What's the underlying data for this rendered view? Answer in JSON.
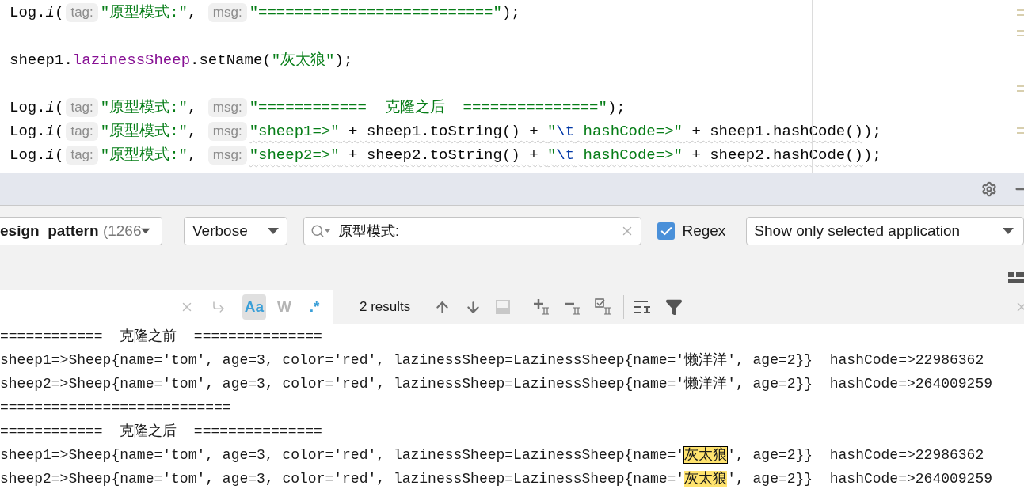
{
  "editor": {
    "lines": [
      {
        "kind": "code",
        "segments": [
          {
            "kind": "plain",
            "text": "Log."
          },
          {
            "kind": "method",
            "text": "i"
          },
          {
            "kind": "plain",
            "text": "("
          },
          {
            "kind": "hint",
            "text": "tag:"
          },
          {
            "kind": "string",
            "text": "\"原型模式:\""
          },
          {
            "kind": "plain",
            "text": ", "
          },
          {
            "kind": "hint",
            "text": "msg:"
          },
          {
            "kind": "string",
            "text": "\"==========================\""
          },
          {
            "kind": "plain",
            "text": ");"
          }
        ]
      },
      {
        "kind": "blank"
      },
      {
        "kind": "code",
        "segments": [
          {
            "kind": "plain",
            "text": "sheep1."
          },
          {
            "kind": "field",
            "text": "lazinessSheep"
          },
          {
            "kind": "plain",
            "text": ".setName("
          },
          {
            "kind": "string",
            "text": "\"灰太狼\""
          },
          {
            "kind": "plain",
            "text": ");"
          }
        ]
      },
      {
        "kind": "blank"
      },
      {
        "kind": "code",
        "segments": [
          {
            "kind": "plain",
            "text": "Log."
          },
          {
            "kind": "method",
            "text": "i"
          },
          {
            "kind": "plain",
            "text": "("
          },
          {
            "kind": "hint",
            "text": "tag:"
          },
          {
            "kind": "string",
            "text": "\"原型模式:\""
          },
          {
            "kind": "plain",
            "text": ", "
          },
          {
            "kind": "hint",
            "text": "msg:"
          },
          {
            "kind": "string",
            "text": "\"============  克隆之后  ===============\""
          },
          {
            "kind": "plain",
            "text": ");"
          }
        ]
      },
      {
        "kind": "code",
        "segments": [
          {
            "kind": "plain",
            "text": "Log."
          },
          {
            "kind": "method",
            "text": "i"
          },
          {
            "kind": "plain",
            "text": "("
          },
          {
            "kind": "hint",
            "text": "tag:"
          },
          {
            "kind": "string",
            "text": "\"原型模式:\""
          },
          {
            "kind": "plain",
            "text": ", "
          },
          {
            "kind": "hint",
            "text": "msg:"
          },
          {
            "kind": "string",
            "text": "\"sheep1=>\"",
            "underlined": true
          },
          {
            "kind": "plain",
            "text": " + sheep1.toString() + ",
            "underlined": true
          },
          {
            "kind": "string",
            "text": "\"",
            "underlined": true
          },
          {
            "kind": "escape",
            "text": "\\t",
            "underlined": true
          },
          {
            "kind": "string",
            "text": " hashCode=>\"",
            "underlined": true
          },
          {
            "kind": "plain",
            "text": " + sheep1.hashCode()",
            "underlined": true
          },
          {
            "kind": "plain",
            "text": ");"
          }
        ]
      },
      {
        "kind": "code",
        "segments": [
          {
            "kind": "plain",
            "text": "Log."
          },
          {
            "kind": "method",
            "text": "i"
          },
          {
            "kind": "plain",
            "text": "("
          },
          {
            "kind": "hint",
            "text": "tag:"
          },
          {
            "kind": "string",
            "text": "\"原型模式:\""
          },
          {
            "kind": "plain",
            "text": ", "
          },
          {
            "kind": "hint",
            "text": "msg:"
          },
          {
            "kind": "string",
            "text": "\"sheep2=>\"",
            "underlined": true
          },
          {
            "kind": "plain",
            "text": " + sheep2.toString() + ",
            "underlined": true
          },
          {
            "kind": "string",
            "text": "\"",
            "underlined": true
          },
          {
            "kind": "escape",
            "text": "\\t",
            "underlined": true
          },
          {
            "kind": "string",
            "text": " hashCode=>\"",
            "underlined": true
          },
          {
            "kind": "plain",
            "text": " + sheep2.hashCode()",
            "underlined": true
          },
          {
            "kind": "plain",
            "text": ");"
          }
        ]
      }
    ]
  },
  "filters": {
    "process": {
      "name": "esign_pattern",
      "pid": "(1266"
    },
    "level": "Verbose",
    "search": {
      "value": "原型模式:"
    },
    "regex": {
      "label": "Regex",
      "checked": true
    },
    "scope": "Show only selected application"
  },
  "find_bar": {
    "toggles": [
      {
        "text": "Aa",
        "on": true,
        "hovered": true
      },
      {
        "text": "W",
        "on": false,
        "hovered": false
      },
      {
        "text": ".*",
        "on": true,
        "hovered": false
      }
    ],
    "results": "2 results"
  },
  "log_lines": [
    {
      "segments": [
        {
          "text": "============  克隆之前  ===============",
          "matched": false,
          "current": false
        }
      ]
    },
    {
      "segments": [
        {
          "text": "sheep1=>Sheep{name='tom', age=3, color='red', lazinessSheep=LazinessSheep{name='懒洋洋', age=2}}  hashCode=>22986362",
          "matched": false,
          "current": false
        }
      ]
    },
    {
      "segments": [
        {
          "text": "sheep2=>Sheep{name='tom', age=3, color='red', lazinessSheep=LazinessSheep{name='懒洋洋', age=2}}  hashCode=>264009259",
          "matched": false,
          "current": false
        }
      ]
    },
    {
      "segments": [
        {
          "text": "===========================",
          "matched": false,
          "current": false
        }
      ]
    },
    {
      "segments": [
        {
          "text": "============  克隆之后  ===============",
          "matched": false,
          "current": false
        }
      ]
    },
    {
      "segments": [
        {
          "text": "sheep1=>Sheep{name='tom', age=3, color='red', lazinessSheep=LazinessSheep{name='",
          "matched": false,
          "current": false
        },
        {
          "text": "灰太狼",
          "matched": true,
          "current": true
        },
        {
          "text": "', age=2}}  hashCode=>22986362",
          "matched": false,
          "current": false
        }
      ]
    },
    {
      "segments": [
        {
          "text": "sheep2=>Sheep{name='tom', age=3, color='red', lazinessSheep=LazinessSheep{name='",
          "matched": false,
          "current": false
        },
        {
          "text": "灰太狼",
          "matched": true,
          "current": false
        },
        {
          "text": "', age=2}}  hashCode=>264009259",
          "matched": false,
          "current": false
        }
      ]
    }
  ]
}
